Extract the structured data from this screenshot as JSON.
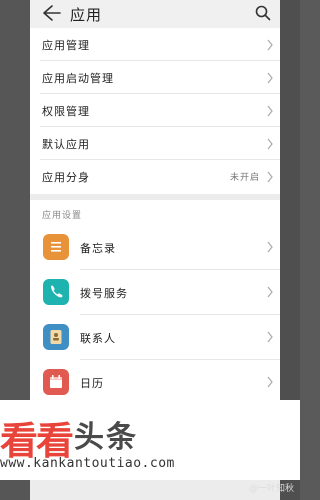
{
  "header": {
    "title": "应用",
    "back_icon": "back-arrow-icon",
    "search_icon": "search-icon"
  },
  "settings_list": [
    {
      "label": "应用管理",
      "value": ""
    },
    {
      "label": "应用启动管理",
      "value": ""
    },
    {
      "label": "权限管理",
      "value": ""
    },
    {
      "label": "默认应用",
      "value": ""
    },
    {
      "label": "应用分身",
      "value": "未开启"
    }
  ],
  "app_settings": {
    "section_title": "应用设置",
    "items": [
      {
        "label": "备忘录",
        "icon": "notes-icon",
        "color": "#e8923a"
      },
      {
        "label": "拨号服务",
        "icon": "phone-icon",
        "color": "#1fb3b0"
      },
      {
        "label": "联系人",
        "icon": "contacts-icon",
        "color": "#3f8ec4"
      },
      {
        "label": "日历",
        "icon": "calendar-icon",
        "color": "#e05a52"
      }
    ]
  },
  "watermark": {
    "brand_left": "看看",
    "brand_right": "头条",
    "url": "www.kankantoutiao.com",
    "corner_text": "@一叶知秋"
  },
  "colors": {
    "watermark_red": "#e9443a",
    "background": "#ececec"
  }
}
